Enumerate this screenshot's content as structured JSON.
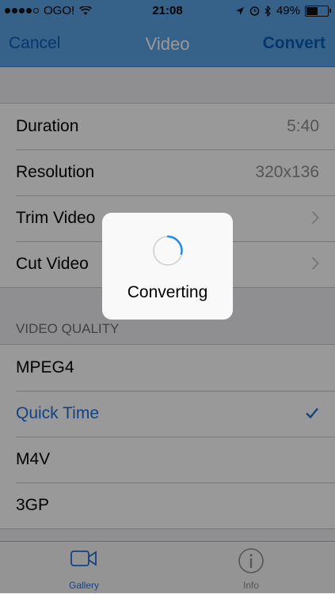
{
  "status_bar": {
    "carrier": "OGO!",
    "time": "21:08",
    "battery_percent_text": "49%",
    "battery_level": 0.49,
    "signal_bars_filled": 4,
    "icons": [
      "signal-dots-icon",
      "wifi-icon",
      "location-arrow-icon",
      "alarm-icon",
      "bluetooth-icon",
      "battery-icon"
    ]
  },
  "nav": {
    "cancel": "Cancel",
    "title": "Video",
    "convert": "Convert"
  },
  "info_rows": [
    {
      "label": "Duration",
      "value": "5:40"
    },
    {
      "label": "Resolution",
      "value": "320x136"
    },
    {
      "label": "Trim Video",
      "value": ""
    },
    {
      "label": "Cut Video",
      "value": ""
    }
  ],
  "quality": {
    "header": "VIDEO QUALITY",
    "options": [
      {
        "label": "MPEG4",
        "selected": false
      },
      {
        "label": "Quick Time",
        "selected": true
      },
      {
        "label": "M4V",
        "selected": false
      },
      {
        "label": "3GP",
        "selected": false
      }
    ]
  },
  "tabs": {
    "gallery": "Gallery",
    "info": "Info"
  },
  "hud": {
    "label": "Converting"
  },
  "colors": {
    "nav_background": "#5aa4e6",
    "accent": "#1f6fd8",
    "overlay": "rgba(0,0,0,0.4)"
  }
}
